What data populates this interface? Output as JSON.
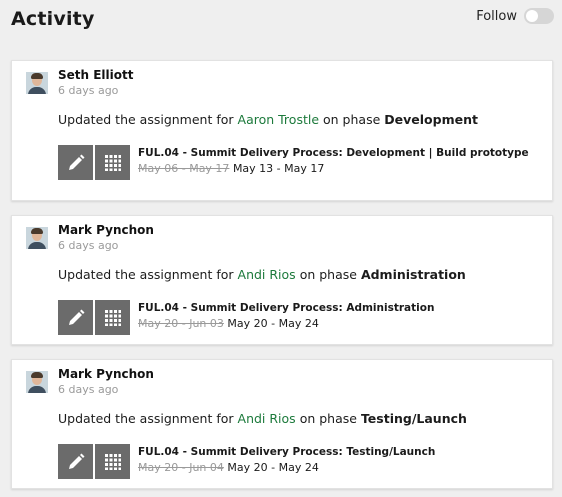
{
  "header": {
    "title": "Activity",
    "follow_label": "Follow",
    "follow_enabled": false
  },
  "activities": [
    {
      "user": "Seth Elliott",
      "time_ago": "6 days ago",
      "message_prefix": "Updated the assignment for",
      "assignee": "Aaron Trostle",
      "message_mid": "on phase",
      "phase": "Development",
      "task_name": "FUL.04 - Summit Delivery Process: Development | Build prototype",
      "old_dates": "May 06 - May 17",
      "new_dates": "May 13 - May 17",
      "edit_icon": "pencil-icon",
      "calendar_icon": "calendar-grid-icon"
    },
    {
      "user": "Mark Pynchon",
      "time_ago": "6 days ago",
      "message_prefix": "Updated the assignment for",
      "assignee": "Andi Rios",
      "message_mid": "on phase",
      "phase": "Administration",
      "task_name": "FUL.04 - Summit Delivery Process: Administration",
      "old_dates": "May 20 - Jun 03",
      "new_dates": "May 20 - May 24",
      "edit_icon": "pencil-icon",
      "calendar_icon": "calendar-grid-icon"
    },
    {
      "user": "Mark Pynchon",
      "time_ago": "6 days ago",
      "message_prefix": "Updated the assignment for",
      "assignee": "Andi Rios",
      "message_mid": "on phase",
      "phase": "Testing/Launch",
      "task_name": "FUL.04 - Summit Delivery Process: Testing/Launch",
      "old_dates": "May 20 - Jun 04",
      "new_dates": "May 20 - May 24",
      "edit_icon": "pencil-icon",
      "calendar_icon": "calendar-grid-icon"
    }
  ],
  "colors": {
    "background": "#efefef",
    "link": "#1d7a3c",
    "icon_button": "#6b6b6b",
    "muted": "#9a9a9a"
  }
}
